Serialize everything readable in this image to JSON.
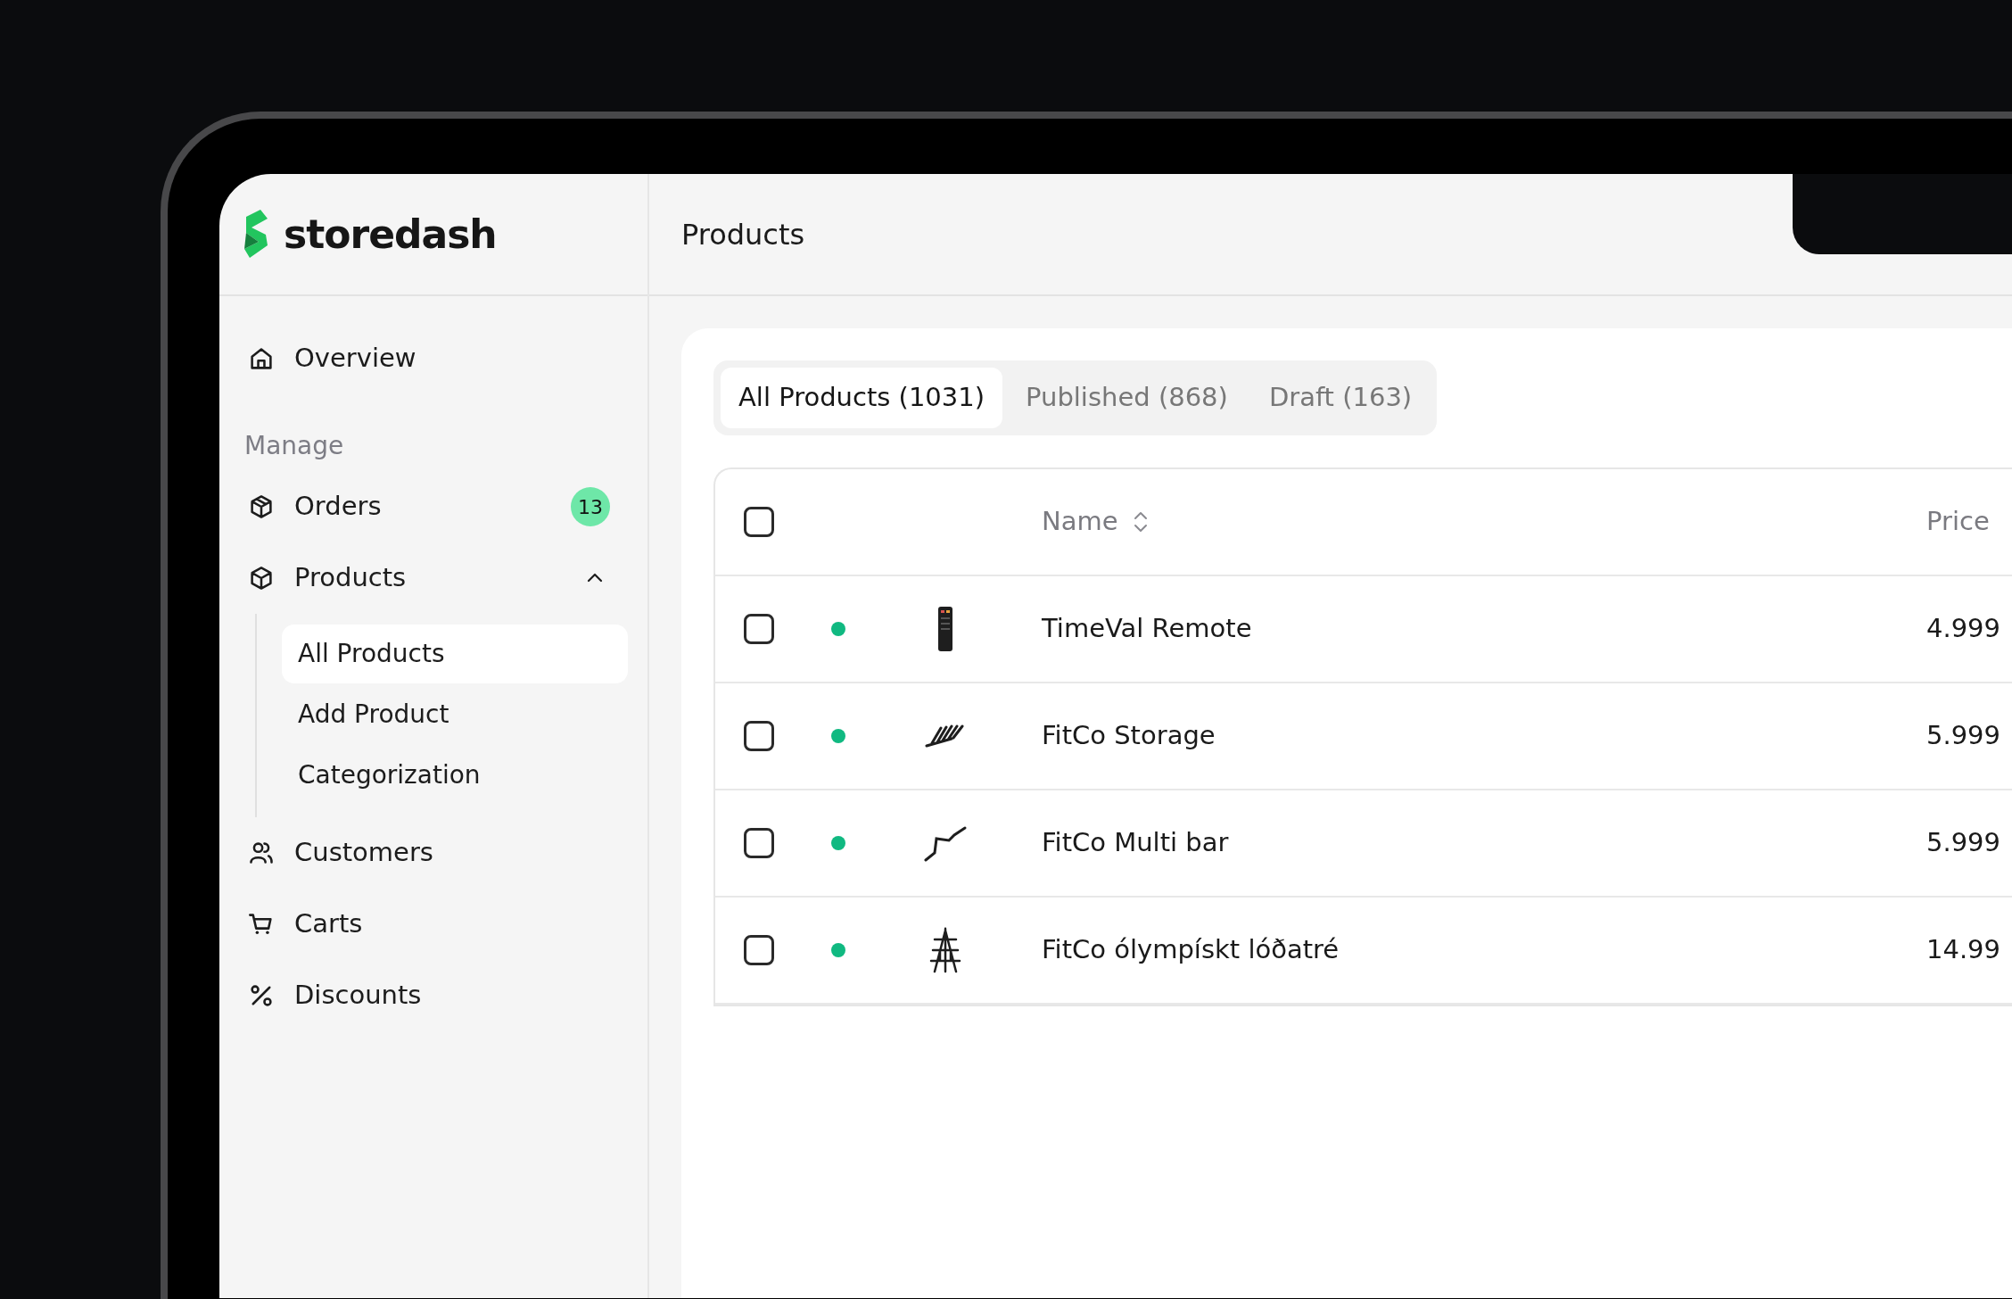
{
  "brand": {
    "name": "storedash"
  },
  "page_title": "Products",
  "sidebar": {
    "items": [
      {
        "kind": "link",
        "label": "Overview"
      },
      {
        "kind": "heading",
        "label": "Manage"
      },
      {
        "kind": "link",
        "label": "Orders",
        "badge": "13"
      },
      {
        "kind": "group",
        "label": "Products",
        "expanded": true,
        "children": [
          {
            "label": "All Products",
            "selected": true
          },
          {
            "label": "Add Product",
            "selected": false
          },
          {
            "label": "Categorization",
            "selected": false
          }
        ]
      },
      {
        "kind": "link",
        "label": "Customers"
      },
      {
        "kind": "link",
        "label": "Carts"
      },
      {
        "kind": "link",
        "label": "Discounts"
      }
    ]
  },
  "tabs": [
    {
      "label": "All Products (1031)",
      "selected": true
    },
    {
      "label": "Published (868)",
      "selected": false
    },
    {
      "label": "Draft (163)",
      "selected": false
    }
  ],
  "table": {
    "select_all": {
      "checked": false
    },
    "columns": [
      "Name",
      "Price"
    ],
    "rows": [
      {
        "checked": false,
        "color": "#10b981",
        "name": "TimeVal Remote",
        "price": "4.999"
      },
      {
        "checked": false,
        "color": "#10b981",
        "name": "FitCo Storage",
        "price": "5.999"
      },
      {
        "checked": false,
        "color": "#10b981",
        "name": "FitCo Multi bar",
        "price": "5.999"
      },
      {
        "checked": false,
        "color": "#10b981",
        "name": "FitCo ólympískt lóðatré",
        "price": "14.99"
      }
    ]
  }
}
